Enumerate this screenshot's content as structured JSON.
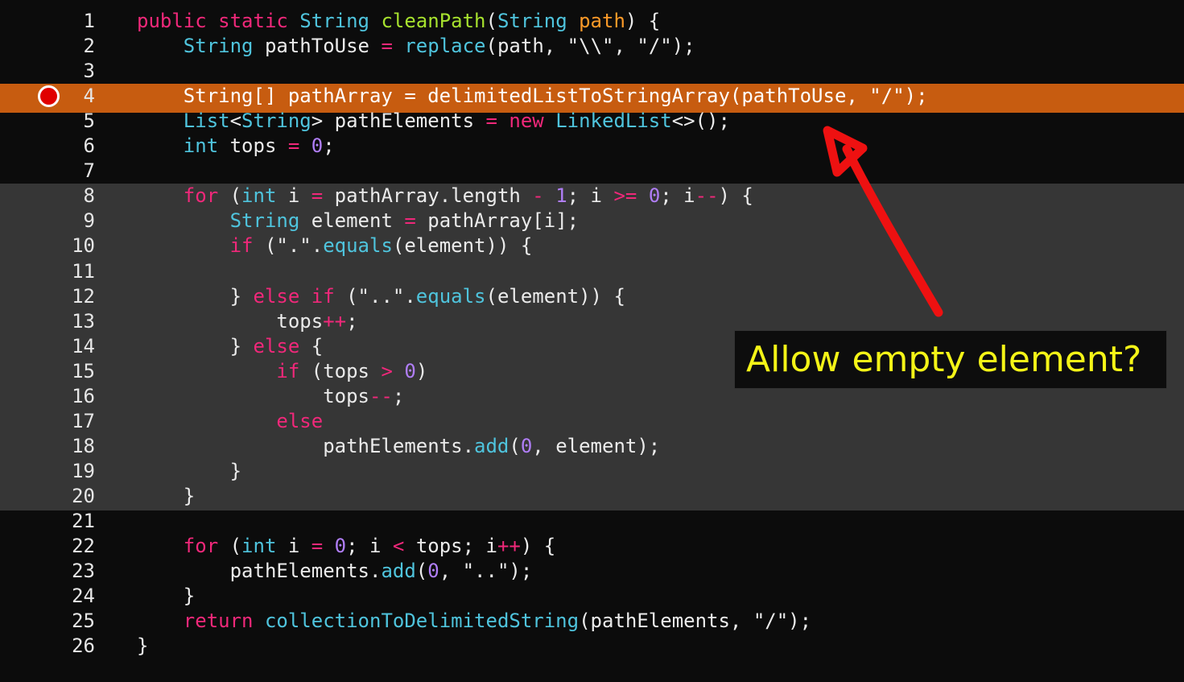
{
  "colors": {
    "background": "#0c0c0c",
    "dimmed_band": "#363636",
    "breakpoint_line": "#c75c10",
    "breakpoint_dot": "#e00000",
    "annotation_text": "#f4f417",
    "arrow": "#ee1111"
  },
  "icons": {
    "breakpoint": "breakpoint-icon",
    "arrow": "annotation-arrow-icon"
  },
  "annotation": {
    "text": "Allow empty element?"
  },
  "lines": [
    {
      "n": "1",
      "t": [
        [
          "public static ",
          "kw-magenta"
        ],
        [
          "String ",
          "kw-cyan"
        ],
        [
          "cleanPath",
          "fn-green"
        ],
        [
          "(",
          ""
        ],
        [
          "String ",
          "kw-cyan"
        ],
        [
          "path",
          "param"
        ],
        [
          ") {",
          ""
        ]
      ]
    },
    {
      "n": "2",
      "t": [
        [
          "    String ",
          "kw-cyan"
        ],
        [
          "pathToUse ",
          ""
        ],
        [
          "= ",
          "op"
        ],
        [
          "replace",
          "kw-cyan"
        ],
        [
          "(path, ",
          ""
        ],
        [
          "\"\\\\\"",
          "str"
        ],
        [
          ", ",
          ""
        ],
        [
          "\"/\"",
          "str"
        ],
        [
          ");",
          ""
        ]
      ]
    },
    {
      "n": "3",
      "t": []
    },
    {
      "n": "4",
      "t": [
        [
          "    String[] pathArray = delimitedListToStringArray(pathToUse, \"/\");",
          ""
        ]
      ]
    },
    {
      "n": "5",
      "t": [
        [
          "    List",
          "kw-cyan"
        ],
        [
          "<",
          ""
        ],
        [
          "String",
          "kw-cyan"
        ],
        [
          "> pathElements ",
          ""
        ],
        [
          "= ",
          "op"
        ],
        [
          "new ",
          "kw-magenta"
        ],
        [
          "LinkedList",
          "kw-cyan"
        ],
        [
          "<>();",
          ""
        ]
      ]
    },
    {
      "n": "6",
      "t": [
        [
          "    int ",
          "kw-cyan"
        ],
        [
          "tops ",
          ""
        ],
        [
          "= ",
          "op"
        ],
        [
          "0",
          "num"
        ],
        [
          ";",
          ""
        ]
      ]
    },
    {
      "n": "7",
      "t": []
    },
    {
      "n": "8",
      "t": [
        [
          "    ",
          ""
        ],
        [
          "for ",
          "kw-magenta"
        ],
        [
          "(",
          ""
        ],
        [
          "int ",
          "kw-cyan"
        ],
        [
          "i ",
          ""
        ],
        [
          "= ",
          "op"
        ],
        [
          "pathArray.length ",
          ""
        ],
        [
          "- ",
          "op"
        ],
        [
          "1",
          "num"
        ],
        [
          "; i ",
          ""
        ],
        [
          ">= ",
          "op"
        ],
        [
          "0",
          "num"
        ],
        [
          "; i",
          ""
        ],
        [
          "--",
          "op"
        ],
        [
          ") {",
          ""
        ]
      ]
    },
    {
      "n": "9",
      "t": [
        [
          "        String ",
          "kw-cyan"
        ],
        [
          "element ",
          ""
        ],
        [
          "= ",
          "op"
        ],
        [
          "pathArray[i];",
          ""
        ]
      ]
    },
    {
      "n": "10",
      "t": [
        [
          "        ",
          ""
        ],
        [
          "if ",
          "kw-magenta"
        ],
        [
          "(\".\".",
          ""
        ],
        [
          "equals",
          "kw-cyan"
        ],
        [
          "(element)) {",
          ""
        ]
      ]
    },
    {
      "n": "11",
      "t": []
    },
    {
      "n": "12",
      "t": [
        [
          "        } ",
          ""
        ],
        [
          "else if ",
          "kw-magenta"
        ],
        [
          "(\"..\".",
          ""
        ],
        [
          "equals",
          "kw-cyan"
        ],
        [
          "(element)) {",
          ""
        ]
      ]
    },
    {
      "n": "13",
      "t": [
        [
          "            tops",
          ""
        ],
        [
          "++",
          "op"
        ],
        [
          ";",
          ""
        ]
      ]
    },
    {
      "n": "14",
      "t": [
        [
          "        } ",
          ""
        ],
        [
          "else ",
          "kw-magenta"
        ],
        [
          "{",
          ""
        ]
      ]
    },
    {
      "n": "15",
      "t": [
        [
          "            ",
          ""
        ],
        [
          "if ",
          "kw-magenta"
        ],
        [
          "(tops ",
          ""
        ],
        [
          "> ",
          "op"
        ],
        [
          "0",
          "num"
        ],
        [
          ")",
          ""
        ]
      ]
    },
    {
      "n": "16",
      "t": [
        [
          "                tops",
          ""
        ],
        [
          "--",
          "op"
        ],
        [
          ";",
          ""
        ]
      ]
    },
    {
      "n": "17",
      "t": [
        [
          "            ",
          ""
        ],
        [
          "else",
          "kw-magenta"
        ]
      ]
    },
    {
      "n": "18",
      "t": [
        [
          "                pathElements.",
          ""
        ],
        [
          "add",
          "kw-cyan"
        ],
        [
          "(",
          ""
        ],
        [
          "0",
          "num"
        ],
        [
          ", element);",
          ""
        ]
      ]
    },
    {
      "n": "19",
      "t": [
        [
          "        }",
          ""
        ]
      ]
    },
    {
      "n": "20",
      "t": [
        [
          "    }",
          ""
        ]
      ]
    },
    {
      "n": "21",
      "t": []
    },
    {
      "n": "22",
      "t": [
        [
          "    ",
          ""
        ],
        [
          "for ",
          "kw-magenta"
        ],
        [
          "(",
          ""
        ],
        [
          "int ",
          "kw-cyan"
        ],
        [
          "i ",
          ""
        ],
        [
          "= ",
          "op"
        ],
        [
          "0",
          "num"
        ],
        [
          "; i ",
          ""
        ],
        [
          "< ",
          "op"
        ],
        [
          "tops; i",
          ""
        ],
        [
          "++",
          "op"
        ],
        [
          ") {",
          ""
        ]
      ]
    },
    {
      "n": "23",
      "t": [
        [
          "        pathElements.",
          ""
        ],
        [
          "add",
          "kw-cyan"
        ],
        [
          "(",
          ""
        ],
        [
          "0",
          "num"
        ],
        [
          ", \"..\");",
          ""
        ]
      ]
    },
    {
      "n": "24",
      "t": [
        [
          "    }",
          ""
        ]
      ]
    },
    {
      "n": "25",
      "t": [
        [
          "    ",
          ""
        ],
        [
          "return ",
          "kw-magenta"
        ],
        [
          "collectionToDelimitedString",
          "kw-cyan"
        ],
        [
          "(pathElements, \"/\");",
          ""
        ]
      ]
    },
    {
      "n": "26",
      "t": [
        [
          "}",
          ""
        ]
      ]
    }
  ],
  "breakpoint_line": "4"
}
